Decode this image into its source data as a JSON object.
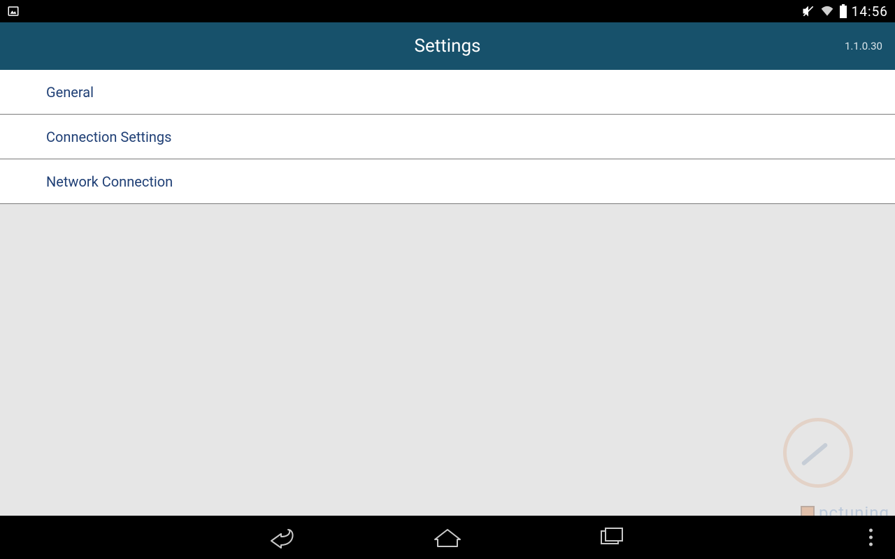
{
  "status_bar": {
    "clock": "14:56",
    "icons": {
      "screenshot": "image-icon",
      "mute": "mute-icon",
      "wifi": "wifi-icon",
      "battery": "battery-icon"
    }
  },
  "title_bar": {
    "title": "Settings",
    "version": "1.1.0.30"
  },
  "items": [
    {
      "label": "General"
    },
    {
      "label": "Connection Settings"
    },
    {
      "label": "Network Connection"
    }
  ],
  "watermark": {
    "text": "pctuning"
  },
  "nav_bar": {
    "back": "back-icon",
    "home": "home-icon",
    "recent": "recent-icon",
    "overflow": "overflow-menu-icon"
  }
}
